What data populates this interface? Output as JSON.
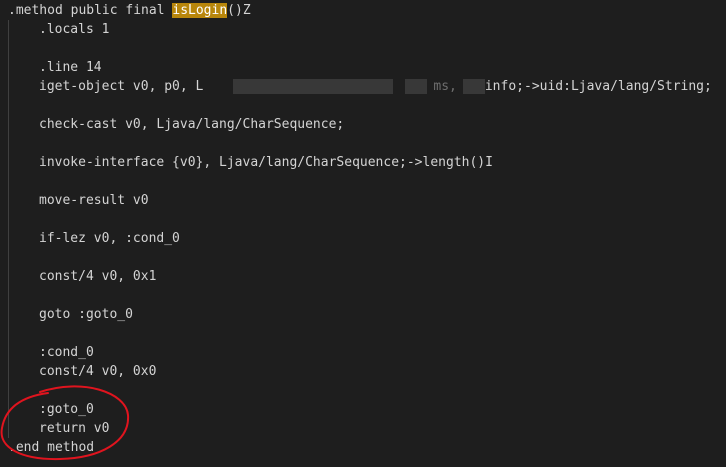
{
  "code": {
    "method_decl_prefix": ".method public final ",
    "method_name": "isLogin",
    "method_decl_suffix": "()Z",
    "locals": ".locals 1",
    "line_directive": ".line 14",
    "iget_prefix": "iget-object v0, p0, L",
    "iget_mid": "ms,",
    "iget_suffix": "info;->uid:Ljava/lang/String;",
    "check_cast": "check-cast v0, Ljava/lang/CharSequence;",
    "invoke": "invoke-interface {v0}, Ljava/lang/CharSequence;->length()I",
    "move_result": "move-result v0",
    "if_lez": "if-lez v0, :cond_0",
    "const_one": "const/4 v0, 0x1",
    "goto": "goto :goto_0",
    "cond_label": ":cond_0",
    "const_zero": "const/4 v0, 0x0",
    "goto_label": ":goto_0",
    "return": "return v0",
    "end_method": ".end method"
  },
  "colors": {
    "background": "#1e1e1e",
    "text": "#d4d4d4",
    "highlight": "#b8860b",
    "annotation": "#e0141e"
  }
}
